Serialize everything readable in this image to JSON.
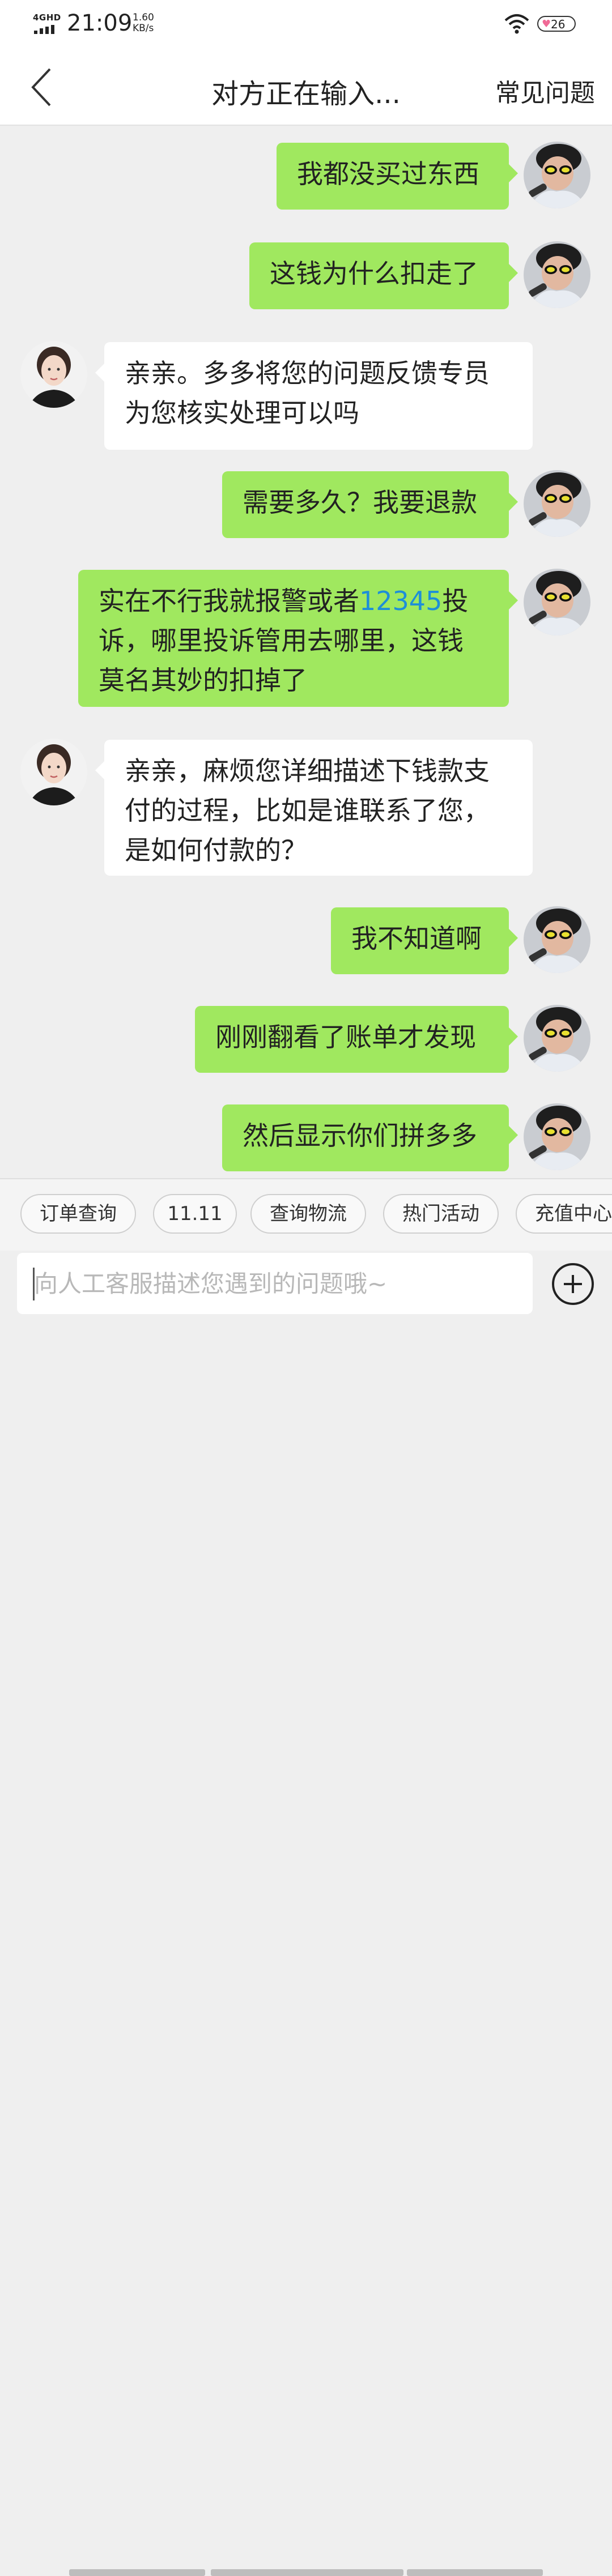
{
  "status_bar": {
    "network": "4GHD",
    "time": "21:09",
    "speed_value": "1.60",
    "speed_unit": "KB/s",
    "battery_level": "26",
    "icons": [
      "signal-icon",
      "wifi-icon",
      "battery-icon"
    ]
  },
  "header": {
    "title": "对方正在输入...",
    "faq_label": "常见问题",
    "back_icon": "chevron-left-icon"
  },
  "messages": [
    {
      "sender": "user",
      "lines": [
        "我都没买过东西"
      ]
    },
    {
      "sender": "user",
      "lines": [
        "这钱为什么扣走了"
      ]
    },
    {
      "sender": "agent",
      "lines": [
        "亲亲。多多将您的问题反馈专员",
        "为您核实处理可以吗"
      ]
    },
    {
      "sender": "user",
      "lines": [
        "需要多久？我要退款"
      ]
    },
    {
      "sender": "user",
      "line1_before": "实在不行我就报警或者",
      "line1_number": "12345",
      "line1_after": "投",
      "line2": "诉，哪里投诉管用去哪里，这钱",
      "line3": "莫名其妙的扣掉了"
    },
    {
      "sender": "agent",
      "lines": [
        "亲亲，麻烦您详细描述下钱款支",
        "付的过程，比如是谁联系了您，",
        "是如何付款的？"
      ]
    },
    {
      "sender": "user",
      "lines": [
        "我不知道啊"
      ]
    },
    {
      "sender": "user",
      "lines": [
        "刚刚翻看了账单才发现"
      ]
    },
    {
      "sender": "user",
      "lines": [
        "然后显示你们拼多多"
      ]
    }
  ],
  "quick_replies": [
    "订单查询",
    "11.11",
    "查询物流",
    "热门活动",
    "充值中心"
  ],
  "input": {
    "placeholder": "向人工客服描述您遇到的问题哦~",
    "value": ""
  },
  "colors": {
    "user_bubble": "#a0e85f",
    "agent_bubble": "#ffffff",
    "link": "#1d8fd8",
    "background": "#efefef"
  }
}
